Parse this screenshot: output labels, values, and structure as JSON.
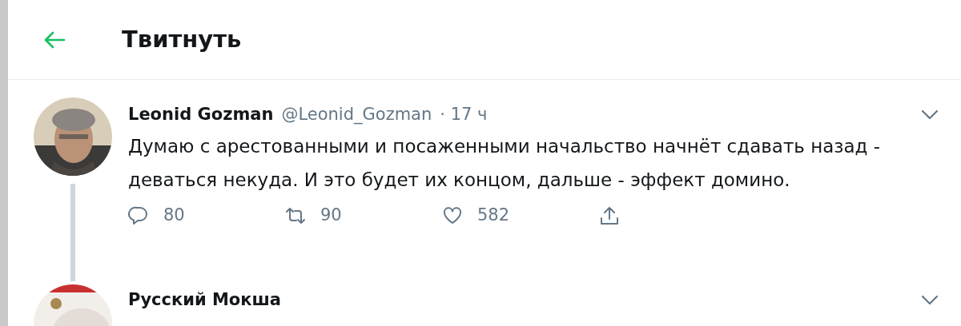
{
  "header": {
    "title": "Твитнуть"
  },
  "tweets": [
    {
      "name": "Leonid Gozman",
      "handle": "@Leonid_Gozman",
      "time": "· 17 ч",
      "text": "Думаю с арестованными и посаженными начальство начнёт сдавать назад - деваться некуда. И это будет их концом, дальше - эффект домино.",
      "replies": "80",
      "retweets": "90",
      "likes": "582"
    },
    {
      "name": "Русский Мокша"
    }
  ]
}
